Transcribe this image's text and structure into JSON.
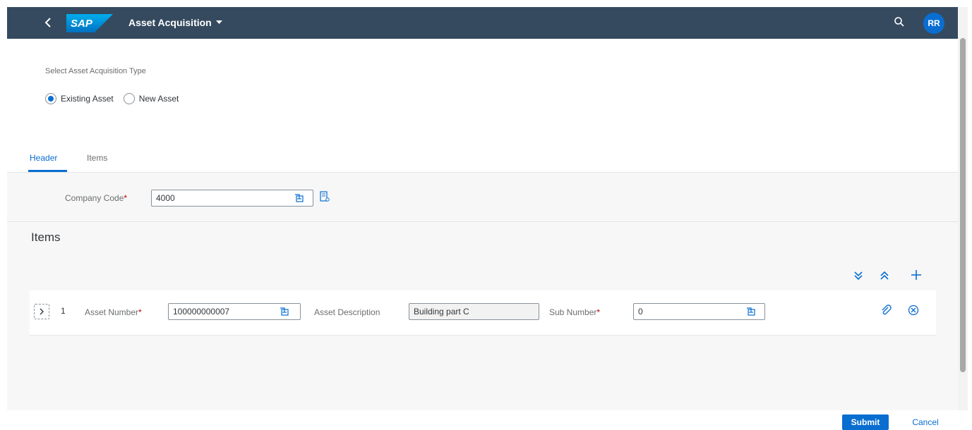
{
  "shell": {
    "app_title": "Asset Acquisition",
    "logo_text": "SAP",
    "avatar_initials": "RR",
    "colors": {
      "shell_bg": "#354a5f",
      "accent": "#0a6ed1"
    }
  },
  "acquisition_type": {
    "label": "Select Asset Acquisition Type",
    "options": [
      {
        "label": "Existing Asset",
        "selected": true
      },
      {
        "label": "New Asset",
        "selected": false
      }
    ]
  },
  "tabs": [
    {
      "label": "Header",
      "active": true
    },
    {
      "label": "Items",
      "active": false
    }
  ],
  "header": {
    "company_code_label": "Company Code",
    "required_marker": "*",
    "company_code_value": "4000"
  },
  "items": {
    "title": "Items",
    "rows": [
      {
        "number": "1",
        "asset_number_label": "Asset Number",
        "asset_number_value": "100000000007",
        "asset_description_label": "Asset Description",
        "asset_description_value": "Building part C",
        "sub_number_label": "Sub Number",
        "sub_number_value": "0"
      }
    ]
  },
  "footer": {
    "submit_label": "Submit",
    "cancel_label": "Cancel"
  }
}
